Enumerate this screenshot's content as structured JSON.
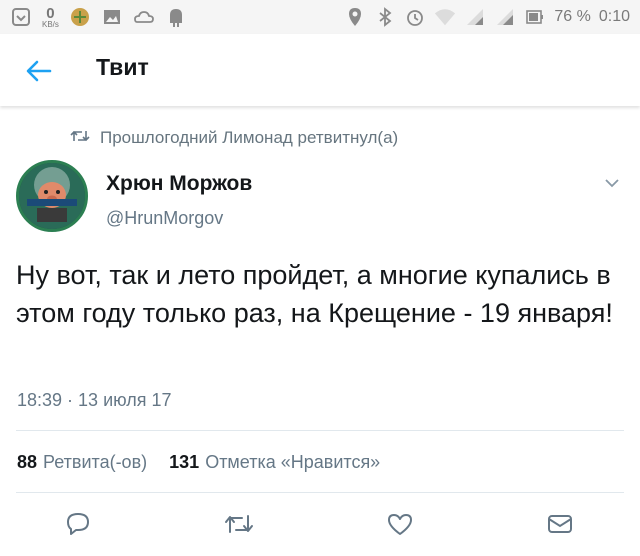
{
  "status_bar": {
    "speed_value": "0",
    "speed_unit": "KB/s",
    "battery_percent": "76 %",
    "time": "0:10",
    "left_icons": [
      "notification-icon",
      "speed-indicator",
      "game-app-icon",
      "image-icon",
      "weather-icon",
      "android-debug-icon"
    ],
    "right_icons": [
      "location-icon",
      "bluetooth-icon",
      "alarm-icon",
      "wifi-icon",
      "signal-icon",
      "signal-icon-2",
      "battery-icon"
    ]
  },
  "header": {
    "title": "Твит",
    "back_icon": "back-arrow-icon"
  },
  "tweet": {
    "retweeted_by": "Прошлогодний Лимонад ретвитнул(а)",
    "author_name": "Хрюн Моржов",
    "author_handle": "@HrunMorgov",
    "text": "Ну вот, так и лето пройдет, а многие купались в этом году только раз, на Крещение - 19 января!",
    "timestamp": "18:39 · 13 июля 17",
    "retweets_count": "88",
    "retweets_label": "Ретвита(-ов)",
    "likes_count": "131",
    "likes_label": "Отметка «Нравится»"
  },
  "actions": [
    "reply-icon",
    "retweet-icon",
    "like-icon",
    "direct-message-icon"
  ],
  "colors": {
    "accent": "#1da1f2",
    "secondary_text": "#657786",
    "primary_text": "#14171a",
    "divider": "#e1e8ed"
  }
}
